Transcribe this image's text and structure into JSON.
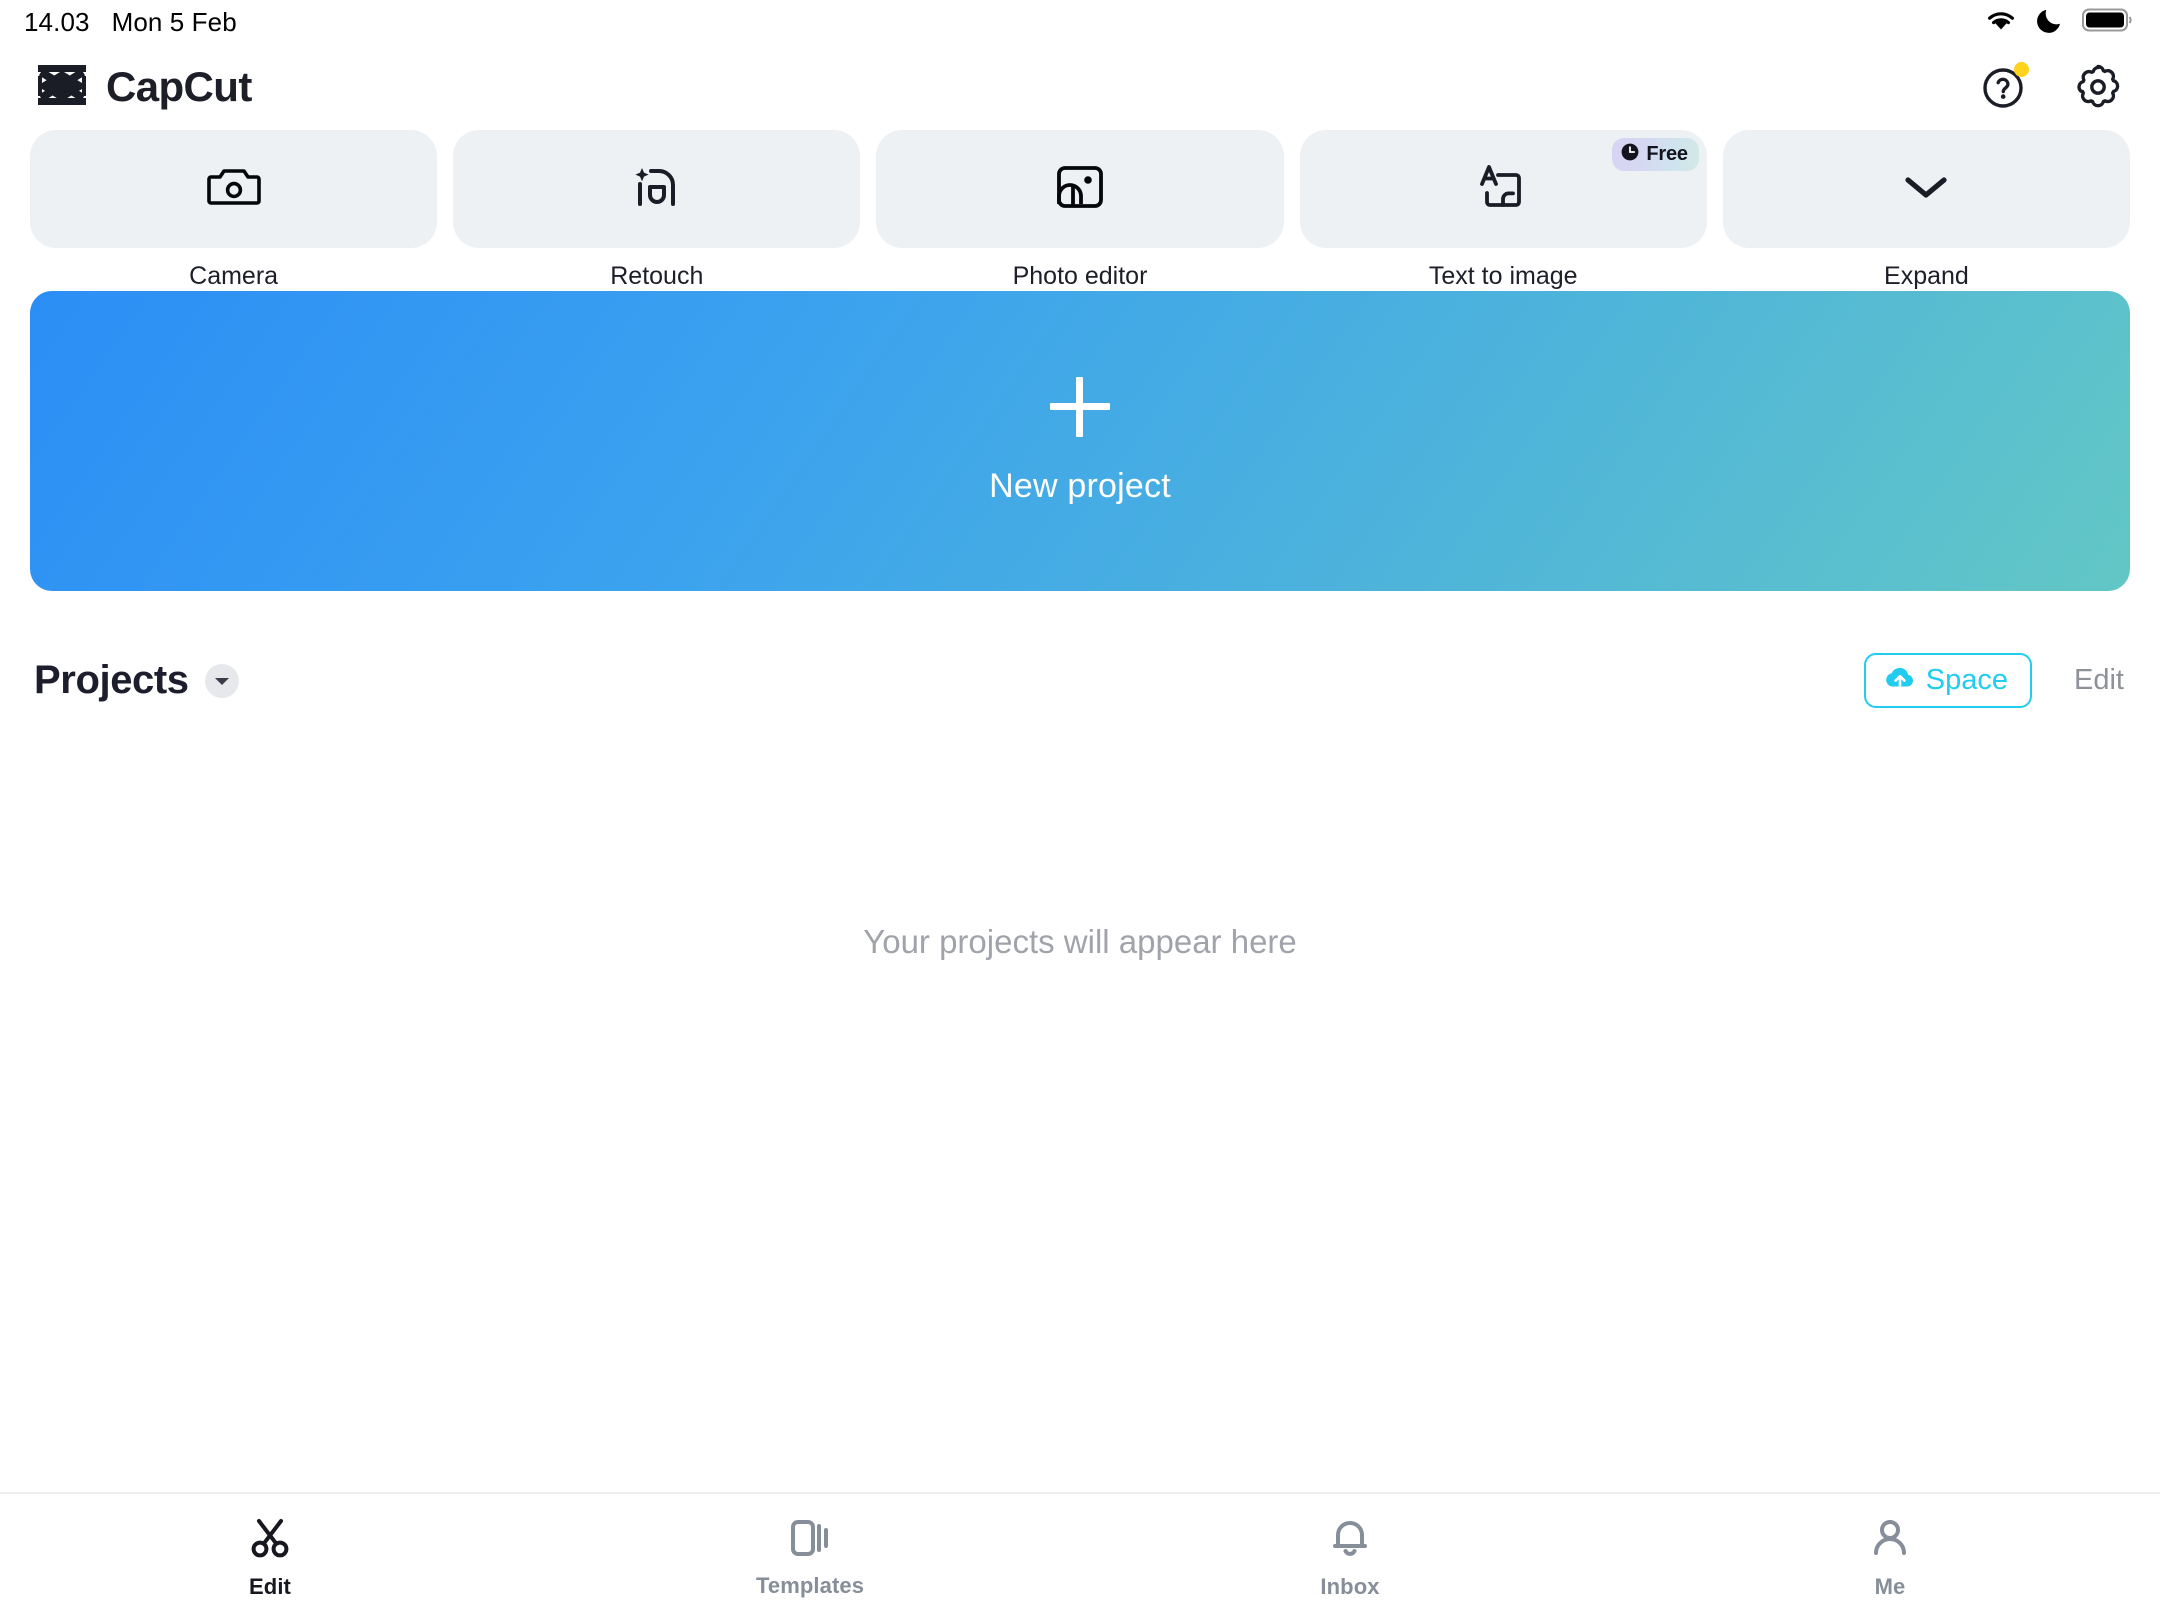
{
  "status_bar": {
    "time": "14.03",
    "date": "Mon 5 Feb",
    "icons": [
      "wifi-icon",
      "do-not-disturb-moon-icon",
      "battery-full-icon"
    ]
  },
  "header": {
    "brand_name": "CapCut",
    "logo_icon": "capcut-logo-icon",
    "help_icon": "help-question-circle-icon",
    "settings_icon": "gear-icon",
    "notification_dot_color": "#ffd21e"
  },
  "tools": [
    {
      "label": "Camera",
      "icon": "camera-icon",
      "badge": null
    },
    {
      "label": "Retouch",
      "icon": "retouch-sparkle-icon",
      "badge": null
    },
    {
      "label": "Photo editor",
      "icon": "photo-editor-image-icon",
      "badge": null
    },
    {
      "label": "Text to image",
      "icon": "text-to-image-icon",
      "badge": "Free"
    },
    {
      "label": "Expand",
      "icon": "chevron-down-icon",
      "badge": null
    }
  ],
  "new_project": {
    "label": "New project",
    "plus_icon": "plus-icon",
    "gradient_from": "#2b8ef5",
    "gradient_to": "#63c7c6"
  },
  "projects_section": {
    "title": "Projects",
    "caret_icon": "caret-down-icon",
    "space_label": "Space",
    "space_icon": "cloud-upload-icon",
    "space_color": "#22ccee",
    "edit_label": "Edit",
    "empty_text": "Your projects will appear here"
  },
  "tab_bar": {
    "active": "Edit",
    "tabs": [
      {
        "label": "Edit",
        "icon": "scissors-icon"
      },
      {
        "label": "Templates",
        "icon": "templates-cards-icon"
      },
      {
        "label": "Inbox",
        "icon": "bell-icon"
      },
      {
        "label": "Me",
        "icon": "person-icon"
      }
    ]
  }
}
